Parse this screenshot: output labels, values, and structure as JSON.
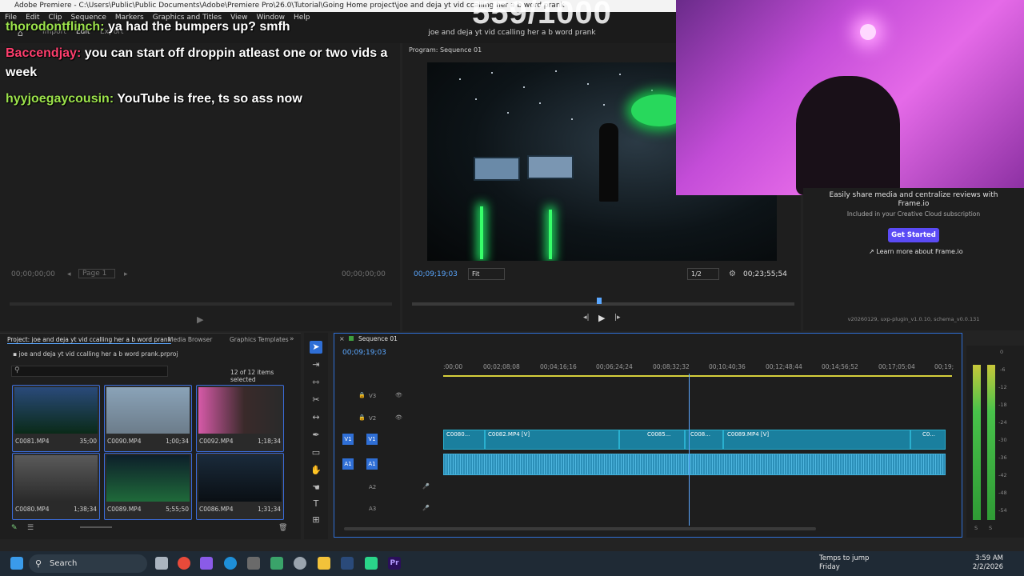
{
  "window": {
    "title": "Adobe Premiere - C:\\Users\\Public\\Public Documents\\Adobe\\Premiere Pro\\26.0\\Tutorial\\Going Home project\\joe and deja yt vid ccalling her a b word prank"
  },
  "menu": [
    "File",
    "Edit",
    "Clip",
    "Sequence",
    "Markers",
    "Graphics and Titles",
    "View",
    "Window",
    "Help"
  ],
  "workspace": {
    "import": "Import",
    "edit": "Edit",
    "export": "Export",
    "project_title": "joe and deja yt vid ccalling her a b word prank",
    "counter": "559/1000"
  },
  "chat": [
    {
      "name": "thorodontflinch:",
      "message": "ya had the bumpers up? smfh"
    },
    {
      "name": "Baccendjay:",
      "message": "you can start off droppin atleast one or two vids a week"
    },
    {
      "name": "hyyjoegaycousin:",
      "message": "YouTube is free, ts so ass now"
    }
  ],
  "source_monitor": {
    "timecode_in": "00;00;00;00",
    "timecode_out": "00;00;00;00",
    "page": "Page 1"
  },
  "program_monitor": {
    "label": "Program: Sequence 01",
    "timecode": "00;09;19;03",
    "fit": "Fit",
    "resolution": "1/2",
    "duration": "00;23;55;54"
  },
  "frame_io": {
    "headline": "Easily share media and centralize reviews with Frame.io",
    "subline": "Included in your Creative Cloud subscription",
    "cta": "Get Started",
    "learn_more": "Learn more about Frame.io",
    "version": "v20260129, uxp-plugin_v1.0.10, schema_v0.0.131"
  },
  "project": {
    "tabs": [
      "Project: joe and deja yt vid ccalling her a b word prank",
      "Media Browser",
      "Graphics Templates"
    ],
    "file": "joe and deja yt vid ccalling her a b word prank.prproj",
    "selection": "12 of 12 items selected",
    "clips": [
      {
        "name": "C0081.MP4",
        "duration": "35;00"
      },
      {
        "name": "C0090.MP4",
        "duration": "1;00;34"
      },
      {
        "name": "C0092.MP4",
        "duration": "1;18;34"
      },
      {
        "name": "C0080.MP4",
        "duration": "1;38;34"
      },
      {
        "name": "C0089.MP4",
        "duration": "5;55;50"
      },
      {
        "name": "C0086.MP4",
        "duration": "1;31;34"
      }
    ]
  },
  "timeline": {
    "tab": "Sequence 01",
    "timecode": "00;09;19;03",
    "ruler": [
      ":00;00",
      "00;02;08;08",
      "00;04;16;16",
      "00;06;24;24",
      "00;08;32;32",
      "00;10;40;36",
      "00;12;48;44",
      "00;14;56;52",
      "00;17;05;04",
      "00;19;"
    ],
    "video_tracks": [
      "V3",
      "V2",
      "V1"
    ],
    "audio_tracks": [
      "A1",
      "A2",
      "A3"
    ],
    "clips": [
      {
        "label": "C0080..."
      },
      {
        "label": "C0082.MP4 [V]"
      },
      {
        "label": "C0085..."
      },
      {
        "label": "C008..."
      },
      {
        "label": "C0089.MP4 [V]"
      },
      {
        "label": "C0..."
      }
    ]
  },
  "meter": {
    "labels": [
      "0",
      "-6",
      "-12",
      "-18",
      "-24",
      "-30",
      "-36",
      "-42",
      "-48",
      "-54"
    ],
    "bottom": [
      "S",
      "S"
    ]
  },
  "taskbar": {
    "search": "Search",
    "weather_title": "Temps to jump",
    "weather_sub": "Friday",
    "time": "3:59 AM",
    "date": "2/2/2026"
  }
}
